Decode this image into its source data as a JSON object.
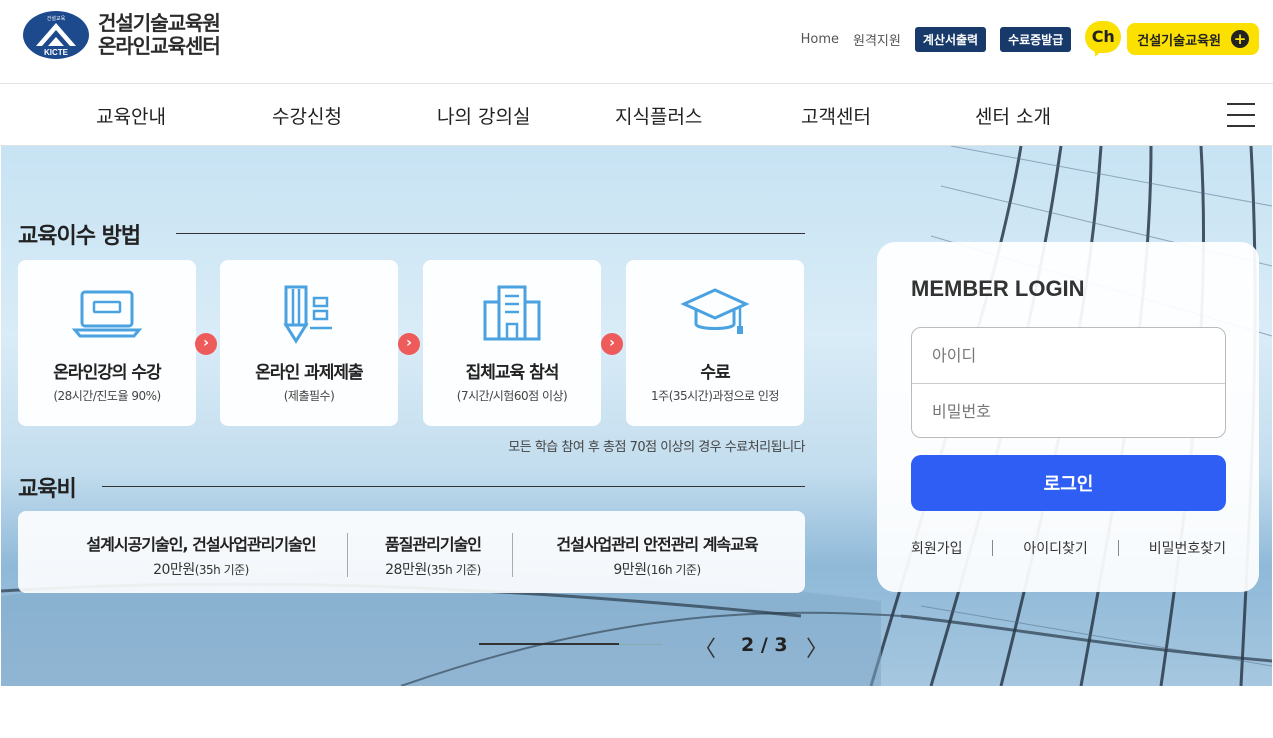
{
  "header": {
    "logo_line1": "건설기술교육원",
    "logo_line2": "온라인교육센터",
    "emblem_text": "KICTE",
    "emblem_top_text": "건설교육",
    "util_links": [
      "Home",
      "원격지원"
    ],
    "util_badges": [
      "계산서출력",
      "수료증발급"
    ],
    "channel_label": "Ch",
    "kakao_label": "건설기술교육원",
    "kakao_icon": "plus-circle-icon"
  },
  "nav": {
    "items": [
      "교육안내",
      "수강신청",
      "나의 강의실",
      "지식플러스",
      "고객센터",
      "센터 소개"
    ],
    "menu_icon": "hamburger-icon"
  },
  "hero": {
    "method_title": "교육이수 방법",
    "steps": [
      {
        "title": "온라인강의 수강",
        "sub": "(28시간/진도율 90%)",
        "icon": "laptop-icon"
      },
      {
        "title": "온라인 과제제출",
        "sub": "(제출필수)",
        "icon": "pencil-doc-icon"
      },
      {
        "title": "집체교육 참석",
        "sub": "(7시간/시험60점 이상)",
        "icon": "building-icon"
      },
      {
        "title": "수료",
        "sub": "1주(35시간)과정으로 인정",
        "icon": "graduation-cap-icon"
      }
    ],
    "step_arrow_glyph": "›",
    "note": "모든 학습 참여 후 총점 70점 이상의 경우 수료처리됩니다",
    "fee_title": "교육비",
    "fees": [
      {
        "name": "설계시공기술인, 건설사업관리기술인",
        "price": "20만원",
        "unit": "(35h 기준)"
      },
      {
        "name": "품질관리기술인",
        "price": "28만원",
        "unit": "(35h 기준)"
      },
      {
        "name": "건설사업관리 안전관리 계속교육",
        "price": "9만원",
        "unit": "(16h 기준)"
      }
    ],
    "pager": {
      "text": "2 / 3",
      "prev": "〈",
      "next": "〉",
      "current": 2,
      "total": 3
    }
  },
  "login": {
    "title": "MEMBER LOGIN",
    "id_placeholder": "아이디",
    "pw_placeholder": "비밀번호",
    "button": "로그인",
    "links": [
      "회원가입",
      "아이디찾기",
      "비밀번호찾기"
    ]
  },
  "colors": {
    "navy": "#173a6a",
    "kakao_yellow": "#fbe000",
    "login_blue": "#2f5ef4",
    "arrow_red": "#ee5b5b",
    "icon_blue": "#4aa3e0"
  }
}
